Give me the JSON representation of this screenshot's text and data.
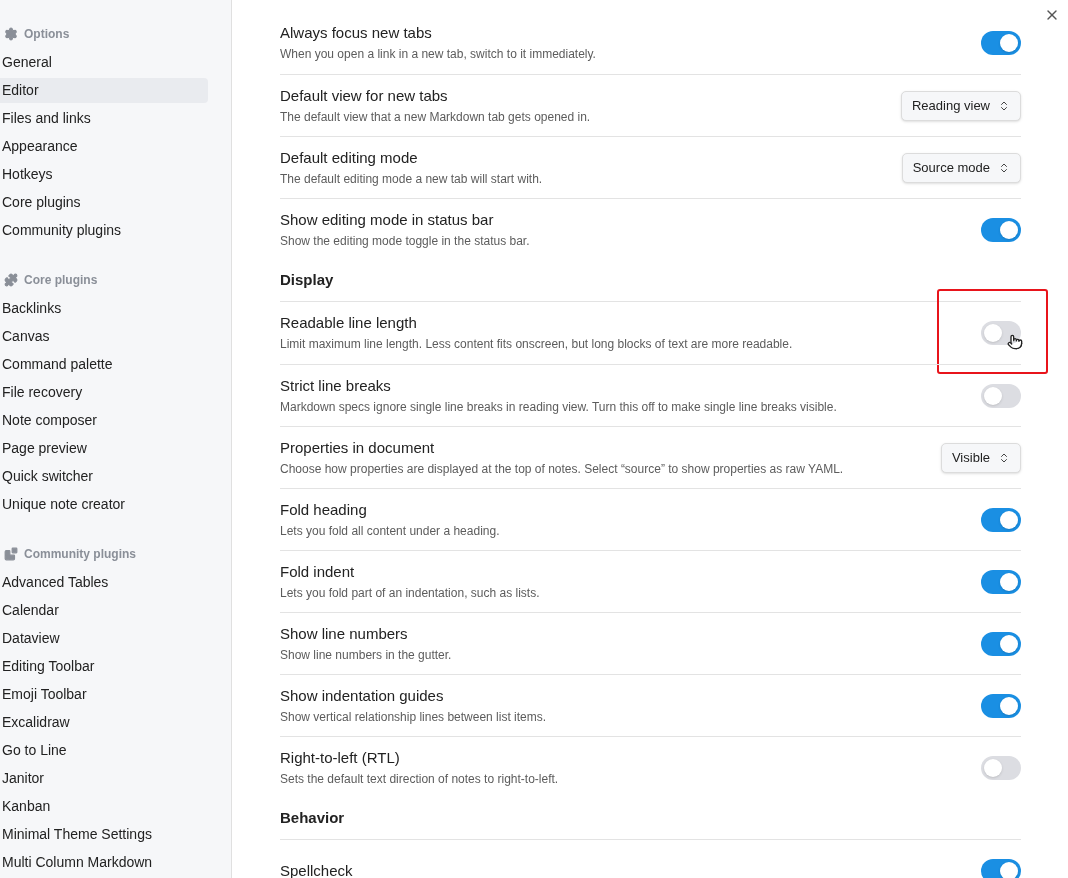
{
  "sidebar": {
    "sections": [
      {
        "heading": "Options",
        "items": [
          {
            "label": "General",
            "selected": false
          },
          {
            "label": "Editor",
            "selected": true
          },
          {
            "label": "Files and links",
            "selected": false
          },
          {
            "label": "Appearance",
            "selected": false
          },
          {
            "label": "Hotkeys",
            "selected": false
          },
          {
            "label": "Core plugins",
            "selected": false
          },
          {
            "label": "Community plugins",
            "selected": false
          }
        ]
      },
      {
        "heading": "Core plugins",
        "items": [
          {
            "label": "Backlinks",
            "selected": false
          },
          {
            "label": "Canvas",
            "selected": false
          },
          {
            "label": "Command palette",
            "selected": false
          },
          {
            "label": "File recovery",
            "selected": false
          },
          {
            "label": "Note composer",
            "selected": false
          },
          {
            "label": "Page preview",
            "selected": false
          },
          {
            "label": "Quick switcher",
            "selected": false
          },
          {
            "label": "Unique note creator",
            "selected": false
          }
        ]
      },
      {
        "heading": "Community plugins",
        "items": [
          {
            "label": "Advanced Tables",
            "selected": false
          },
          {
            "label": "Calendar",
            "selected": false
          },
          {
            "label": "Dataview",
            "selected": false
          },
          {
            "label": "Editing Toolbar",
            "selected": false
          },
          {
            "label": "Emoji Toolbar",
            "selected": false
          },
          {
            "label": "Excalidraw",
            "selected": false
          },
          {
            "label": "Go to Line",
            "selected": false
          },
          {
            "label": "Janitor",
            "selected": false
          },
          {
            "label": "Kanban",
            "selected": false
          },
          {
            "label": "Minimal Theme Settings",
            "selected": false
          },
          {
            "label": "Multi Column Markdown",
            "selected": false
          }
        ]
      }
    ]
  },
  "settings": [
    {
      "kind": "toggle",
      "title": "Always focus new tabs",
      "description": "When you open a link in a new tab, switch to it immediately.",
      "on": true,
      "highlighted": false
    },
    {
      "kind": "dropdown",
      "title": "Default view for new tabs",
      "description": "The default view that a new Markdown tab gets opened in.",
      "value": "Reading view",
      "highlighted": false
    },
    {
      "kind": "dropdown",
      "title": "Default editing mode",
      "description": "The default editing mode a new tab will start with.",
      "value": "Source mode",
      "highlighted": false
    },
    {
      "kind": "toggle",
      "title": "Show editing mode in status bar",
      "description": "Show the editing mode toggle in the status bar.",
      "on": true,
      "highlighted": false
    },
    {
      "kind": "heading",
      "title": "Display"
    },
    {
      "kind": "toggle",
      "title": "Readable line length",
      "description": "Limit maximum line length. Less content fits onscreen, but long blocks of text are more readable.",
      "on": false,
      "highlighted": true
    },
    {
      "kind": "toggle",
      "title": "Strict line breaks",
      "description": "Markdown specs ignore single line breaks in reading view. Turn this off to make single line breaks visible.",
      "on": false,
      "highlighted": false
    },
    {
      "kind": "dropdown",
      "title": "Properties in document",
      "description": "Choose how properties are displayed at the top of notes. Select “source” to show properties as raw YAML.",
      "value": "Visible",
      "highlighted": false
    },
    {
      "kind": "toggle",
      "title": "Fold heading",
      "description": "Lets you fold all content under a heading.",
      "on": true,
      "highlighted": false
    },
    {
      "kind": "toggle",
      "title": "Fold indent",
      "description": "Lets you fold part of an indentation, such as lists.",
      "on": true,
      "highlighted": false
    },
    {
      "kind": "toggle",
      "title": "Show line numbers",
      "description": "Show line numbers in the gutter.",
      "on": true,
      "highlighted": false
    },
    {
      "kind": "toggle",
      "title": "Show indentation guides",
      "description": "Show vertical relationship lines between list items.",
      "on": true,
      "highlighted": false
    },
    {
      "kind": "toggle",
      "title": "Right-to-left (RTL)",
      "description": "Sets the default text direction of notes to right-to-left.",
      "on": false,
      "highlighted": false
    },
    {
      "kind": "heading",
      "title": "Behavior"
    },
    {
      "kind": "toggle",
      "title": "Spellcheck",
      "on": true,
      "highlighted": false
    }
  ]
}
